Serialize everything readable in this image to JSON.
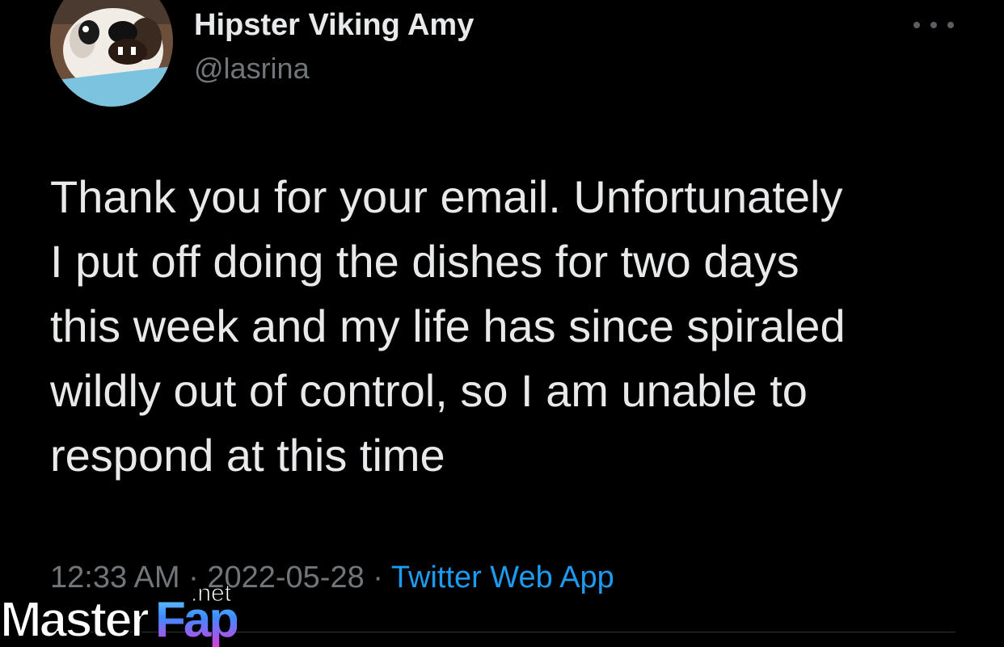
{
  "author": {
    "display_name": "Hipster Viking Amy",
    "handle": "@lasrina"
  },
  "more_icon": "ellipsis-icon",
  "tweet": {
    "text": "Thank you for your email. Unfortunately\nI put off doing the dishes for two days\nthis week and my life has since spiraled\nwildly out of control, so I am unable to\nrespond at this time",
    "time": "12:33 AM",
    "separator": "·",
    "date": "2022-05-28",
    "source": "Twitter Web App"
  },
  "watermark": {
    "brand_master": "Master",
    "brand_fap": "Fap",
    "brand_tld": ".net"
  },
  "colors": {
    "background": "#000000",
    "primary_text": "#e7e9ea",
    "secondary_text": "#71767b",
    "link": "#1d9bf0"
  }
}
